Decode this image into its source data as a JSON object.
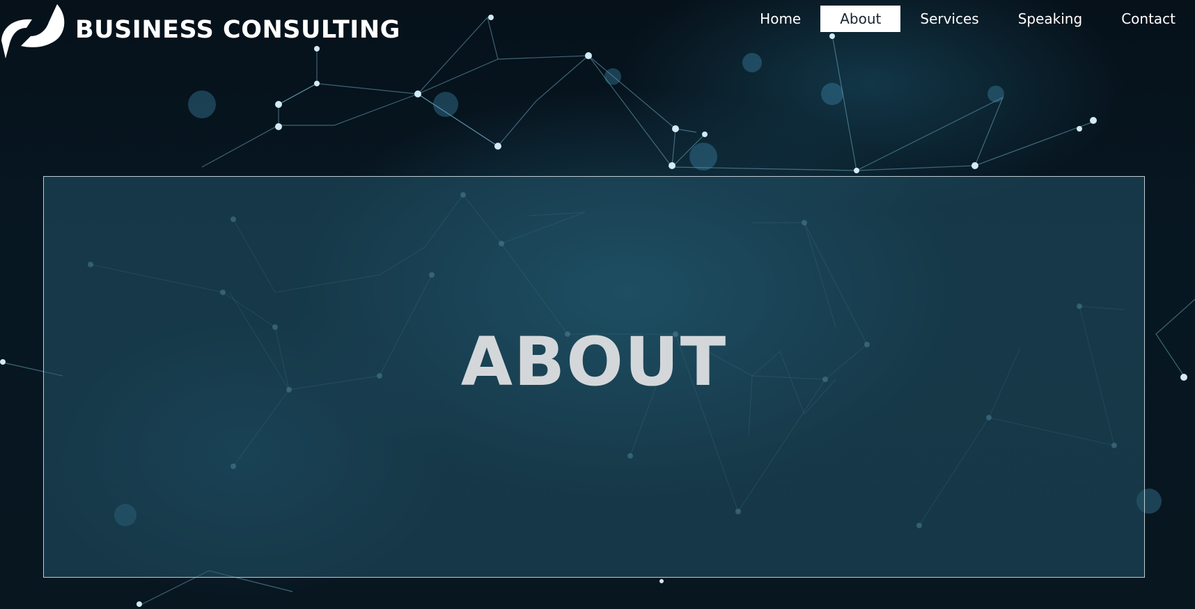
{
  "brand": {
    "name": "BUSINESS CONSULTING",
    "logo_icon": "swirl-logo-icon"
  },
  "nav": {
    "items": [
      {
        "label": "Home",
        "active": false
      },
      {
        "label": "About",
        "active": true
      },
      {
        "label": "Services",
        "active": false
      },
      {
        "label": "Speaking",
        "active": false
      },
      {
        "label": "Contact",
        "active": false
      }
    ]
  },
  "hero": {
    "title": "ABOUT"
  },
  "colors": {
    "nav_active_bg": "#ffffff",
    "panel_bg": "#225468",
    "title_color": "#d4d7da"
  }
}
